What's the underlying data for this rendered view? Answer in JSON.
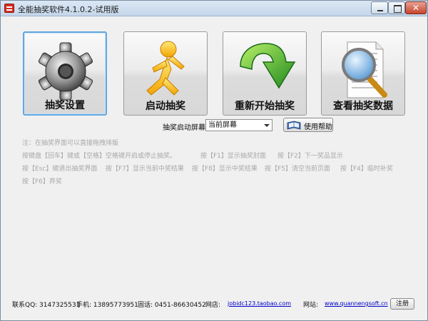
{
  "window": {
    "title": "全能抽奖软件4.1.0.2-试用版"
  },
  "main_buttons": {
    "settings_label": "抽奖设置",
    "start_label": "启动抽奖",
    "restart_label": "重新开始抽奖",
    "view_label": "查看抽奖数据"
  },
  "screen": {
    "label": "抽奖启动屏幕",
    "selected": "当前屏幕"
  },
  "help": {
    "label": "使用帮助"
  },
  "notes": {
    "line1": "注：在抽奖界面可以直接拖拽排版",
    "line2a": "按键盘【回车】键或【空格】空格键开启或停止抽奖。",
    "line2b": "按【F1】显示抽奖封面",
    "line2c": "按【F2】下一奖品显示",
    "line3a": "按【Esc】键退出抽奖界面",
    "line3b": "按【F7】显示当前中奖结果",
    "line3c": "按【F8】显示中奖结果",
    "line3d": "按【F5】清空当前页面",
    "line3e": "按【F4】临时补奖",
    "line4a": "按【F6】弃奖"
  },
  "footer": {
    "qq": "联系QQ: 3147325531",
    "phone": "手机: 13895773951",
    "tel": "固话: 0451-86630452",
    "shop_label": "网店:",
    "shop_link": "jobidc123.taobao.com",
    "site_label": "网站:",
    "site_link": "www.quannengsoft.cn",
    "register": "注册"
  },
  "colors": {
    "active_border": "#61a7e0",
    "note_text": "#a8a8a8",
    "link": "#0000cc"
  }
}
